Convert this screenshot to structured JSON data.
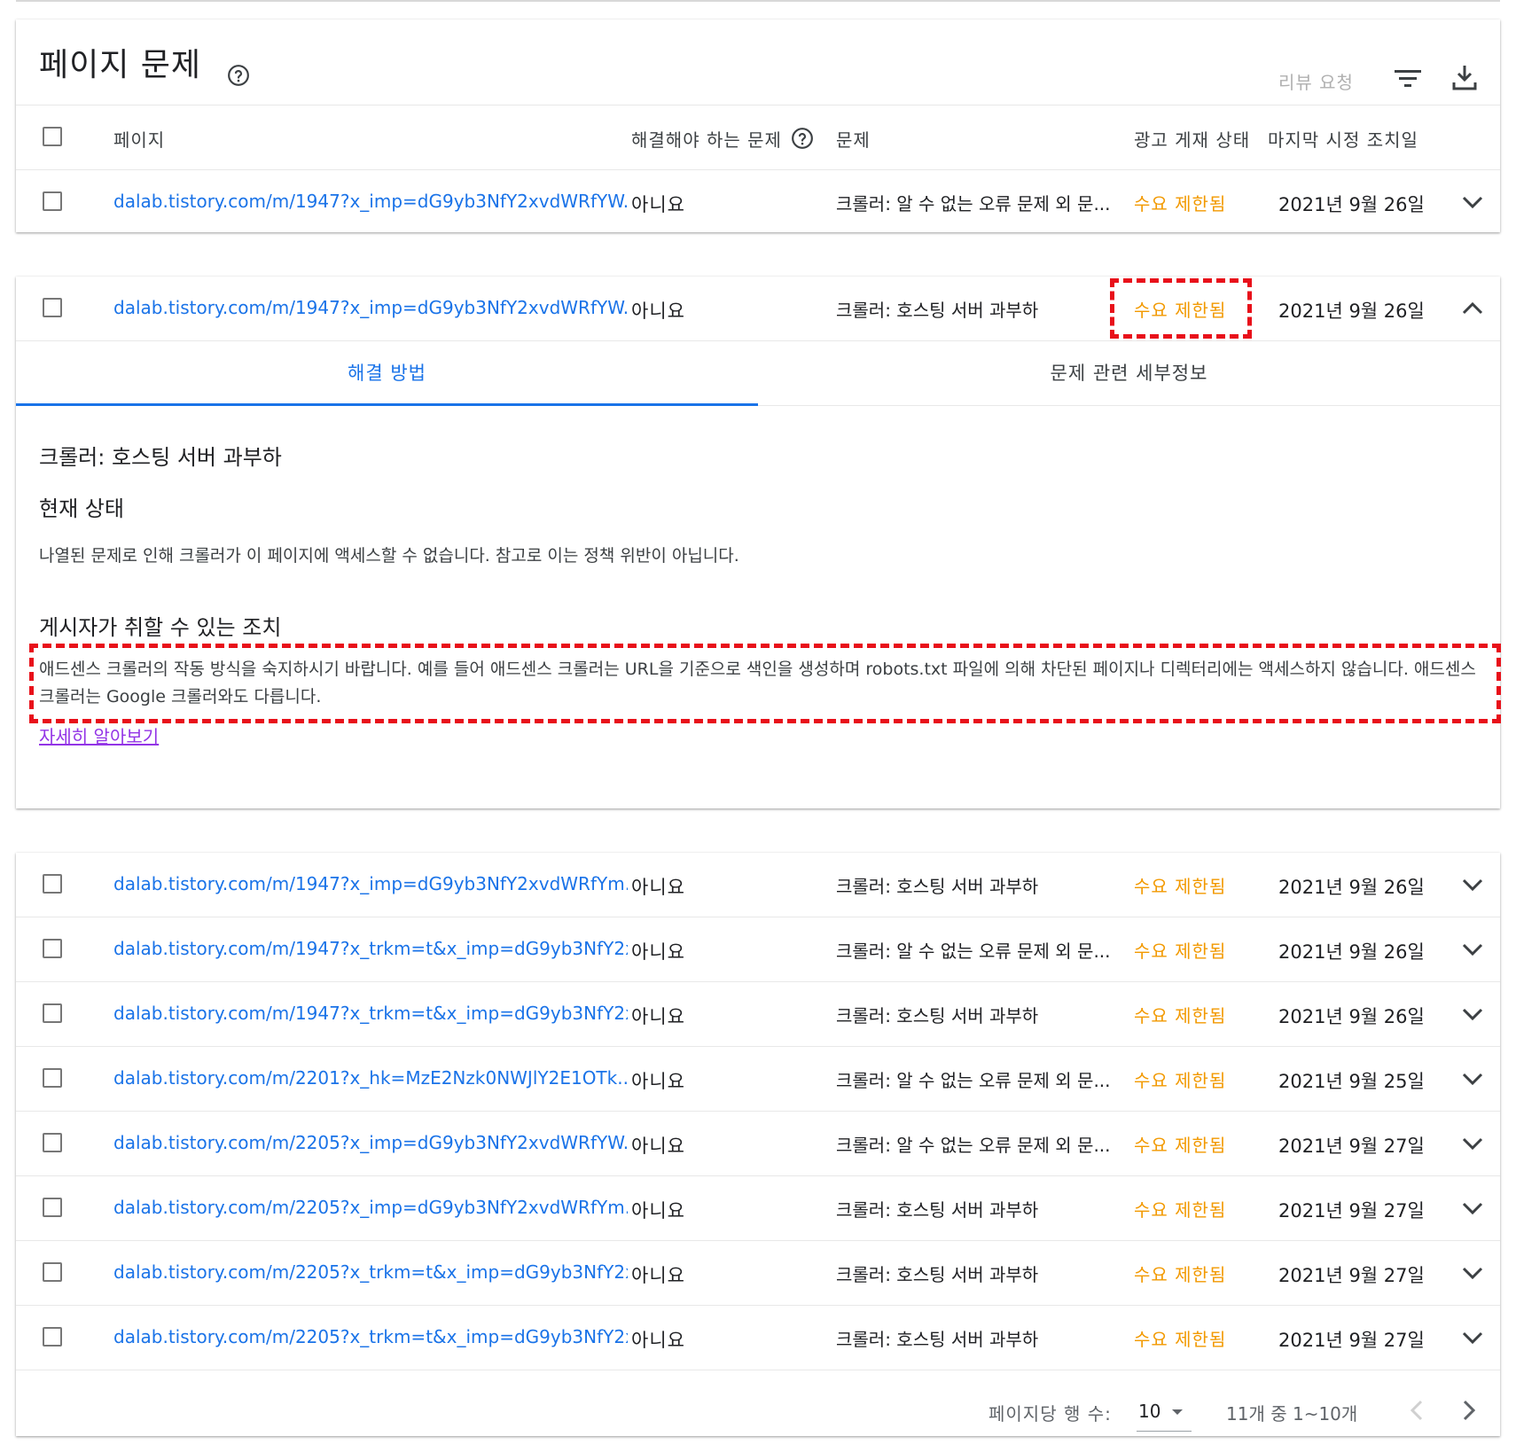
{
  "header": {
    "title": "페이지 문제",
    "review_label": "리뷰 요청"
  },
  "table": {
    "columns": {
      "page": "페이지",
      "must_fix": "해결해야 하는 문제",
      "issue": "문제",
      "ad_status": "광고 게재 상태",
      "last_action": "마지막 시정 조치일"
    },
    "first_row": {
      "page": "dalab.tistory.com/m/1947?x_imp=dG9yb3NfY2xvdWRfYW...",
      "must_fix": "아니요",
      "issue": "크롤러: 알 수 없는 오류 문제 외 문...",
      "status": "수요 제한됨",
      "date": "2021년 9월 26일"
    }
  },
  "expanded": {
    "row": {
      "page": "dalab.tistory.com/m/1947?x_imp=dG9yb3NfY2xvdWRfYW...",
      "must_fix": "아니요",
      "issue": "크롤러: 호스팅 서버 과부하",
      "status": "수요 제한됨",
      "date": "2021년 9월 26일"
    },
    "tabs": [
      "해결 방법",
      "문제 관련 세부정보"
    ],
    "detail": {
      "heading": "크롤러: 호스팅 서버 과부하",
      "current_status_title": "현재 상태",
      "current_status_text": "나열된 문제로 인해 크롤러가 이 페이지에 액세스할 수 없습니다. 참고로 이는 정책 위반이 아닙니다.",
      "actions_title": "게시자가 취할 수 있는 조치",
      "actions_text": "애드센스 크롤러의 작동 방식을 숙지하시기 바랍니다. 예를 들어 애드센스 크롤러는 URL을 기준으로 색인을 생성하며 robots.txt 파일에 의해 차단된 페이지나 디렉터리에는 액세스하지 않습니다. 애드센스 크롤러는 Google 크롤러와도 다릅니다.",
      "learn_more": "자세히 알아보기"
    }
  },
  "rows": [
    {
      "page": "dalab.tistory.com/m/1947?x_imp=dG9yb3NfY2xvdWRfYm...",
      "must_fix": "아니요",
      "issue": "크롤러: 호스팅 서버 과부하",
      "status": "수요 제한됨",
      "date": "2021년 9월 26일"
    },
    {
      "page": "dalab.tistory.com/m/1947?x_trkm=t&x_imp=dG9yb3NfY2x...",
      "must_fix": "아니요",
      "issue": "크롤러: 알 수 없는 오류 문제 외 문...",
      "status": "수요 제한됨",
      "date": "2021년 9월 26일"
    },
    {
      "page": "dalab.tistory.com/m/1947?x_trkm=t&x_imp=dG9yb3NfY2x...",
      "must_fix": "아니요",
      "issue": "크롤러: 호스팅 서버 과부하",
      "status": "수요 제한됨",
      "date": "2021년 9월 26일"
    },
    {
      "page": "dalab.tistory.com/m/2201?x_hk=MzE2Nzk0NWJlY2E1OTk...",
      "must_fix": "아니요",
      "issue": "크롤러: 알 수 없는 오류 문제 외 문...",
      "status": "수요 제한됨",
      "date": "2021년 9월 25일"
    },
    {
      "page": "dalab.tistory.com/m/2205?x_imp=dG9yb3NfY2xvdWRfYW...",
      "must_fix": "아니요",
      "issue": "크롤러: 알 수 없는 오류 문제 외 문...",
      "status": "수요 제한됨",
      "date": "2021년 9월 27일"
    },
    {
      "page": "dalab.tistory.com/m/2205?x_imp=dG9yb3NfY2xvdWRfYm...",
      "must_fix": "아니요",
      "issue": "크롤러: 호스팅 서버 과부하",
      "status": "수요 제한됨",
      "date": "2021년 9월 27일"
    },
    {
      "page": "dalab.tistory.com/m/2205?x_trkm=t&x_imp=dG9yb3NfY2x...",
      "must_fix": "아니요",
      "issue": "크롤러: 호스팅 서버 과부하",
      "status": "수요 제한됨",
      "date": "2021년 9월 27일"
    },
    {
      "page": "dalab.tistory.com/m/2205?x_trkm=t&x_imp=dG9yb3NfY2x...",
      "must_fix": "아니요",
      "issue": "크롤러: 호스팅 서버 과부하",
      "status": "수요 제한됨",
      "date": "2021년 9월 27일"
    }
  ],
  "pagination": {
    "rows_per_page_label": "페이지당 행 수:",
    "rows_per_page": "10",
    "range": "11개 중 1~10개"
  },
  "icons": {
    "help": "help-circle-icon",
    "filter": "filter-list-icon",
    "download": "download-icon",
    "expand": "chevron-down-icon",
    "collapse": "chevron-up-icon",
    "prev": "chevron-left-icon",
    "next": "chevron-right-icon"
  },
  "colors": {
    "link": "#1a73e8",
    "status": "#f29900",
    "highlight": "#e8101a",
    "visited_link": "#9334e6"
  }
}
